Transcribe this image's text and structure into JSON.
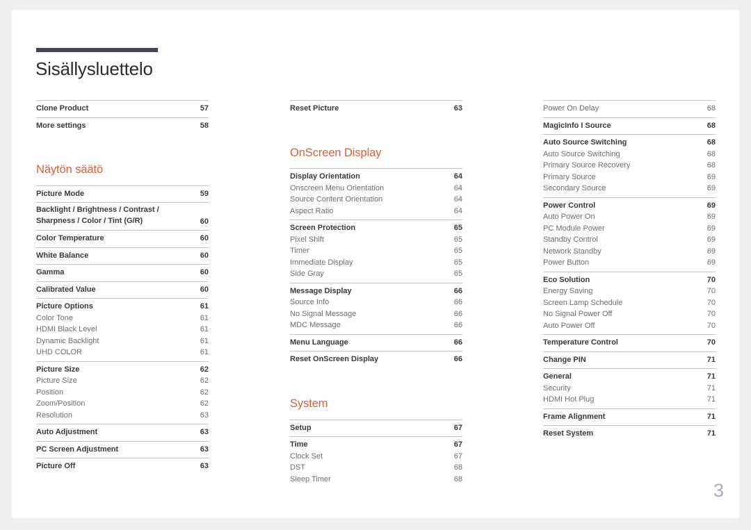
{
  "document": {
    "title": "Sisällysluettelo",
    "folio": "3",
    "accent_color": "#d4603c",
    "rule_color": "#464156"
  },
  "columns": [
    {
      "name": "column-1",
      "blocks": [
        {
          "type": "group",
          "rows": [
            {
              "label": "Clone Product",
              "page": "57",
              "level": "main"
            }
          ]
        },
        {
          "type": "group",
          "rows": [
            {
              "label": "More settings",
              "page": "58",
              "level": "main"
            }
          ]
        },
        {
          "type": "spacer",
          "size": "lg"
        },
        {
          "type": "heading",
          "label": "Näytön säätö"
        },
        {
          "type": "group",
          "rows": [
            {
              "label": "Picture Mode",
              "page": "59",
              "level": "main"
            }
          ]
        },
        {
          "type": "group",
          "rows": [
            {
              "label": "Backlight / Brightness / Contrast / Sharpness / Color / Tint (G/R)",
              "page": "60",
              "level": "main",
              "wrap": true
            }
          ]
        },
        {
          "type": "group",
          "rows": [
            {
              "label": "Color Temperature",
              "page": "60",
              "level": "main"
            }
          ]
        },
        {
          "type": "group",
          "rows": [
            {
              "label": "White Balance",
              "page": "60",
              "level": "main"
            }
          ]
        },
        {
          "type": "group",
          "rows": [
            {
              "label": "Gamma",
              "page": "60",
              "level": "main"
            }
          ]
        },
        {
          "type": "group",
          "rows": [
            {
              "label": "Calibrated Value",
              "page": "60",
              "level": "main"
            }
          ]
        },
        {
          "type": "group",
          "rows": [
            {
              "label": "Picture Options",
              "page": "61",
              "level": "main"
            },
            {
              "label": "Color Tone",
              "page": "61",
              "level": "sub"
            },
            {
              "label": "HDMI Black Level",
              "page": "61",
              "level": "sub"
            },
            {
              "label": "Dynamic Backlight",
              "page": "61",
              "level": "sub"
            },
            {
              "label": "UHD COLOR",
              "page": "61",
              "level": "sub"
            }
          ]
        },
        {
          "type": "group",
          "rows": [
            {
              "label": "Picture Size",
              "page": "62",
              "level": "main"
            },
            {
              "label": "Picture Size",
              "page": "62",
              "level": "sub"
            },
            {
              "label": "Position",
              "page": "62",
              "level": "sub"
            },
            {
              "label": "Zoom/Position",
              "page": "62",
              "level": "sub"
            },
            {
              "label": "Resolution",
              "page": "63",
              "level": "sub"
            }
          ]
        },
        {
          "type": "group",
          "rows": [
            {
              "label": "Auto Adjustment",
              "page": "63",
              "level": "main"
            }
          ]
        },
        {
          "type": "group",
          "rows": [
            {
              "label": "PC Screen Adjustment",
              "page": "63",
              "level": "main"
            }
          ]
        },
        {
          "type": "group",
          "rows": [
            {
              "label": "Picture Off",
              "page": "63",
              "level": "main"
            }
          ]
        }
      ]
    },
    {
      "name": "column-2",
      "blocks": [
        {
          "type": "group",
          "rows": [
            {
              "label": "Reset Picture",
              "page": "63",
              "level": "main"
            }
          ]
        },
        {
          "type": "spacer",
          "size": "lg"
        },
        {
          "type": "heading",
          "label": "OnScreen Display"
        },
        {
          "type": "group",
          "rows": [
            {
              "label": "Display Orientation",
              "page": "64",
              "level": "main"
            },
            {
              "label": "Onscreen Menu Orientation",
              "page": "64",
              "level": "sub"
            },
            {
              "label": "Source Content Orientation",
              "page": "64",
              "level": "sub"
            },
            {
              "label": "Aspect Ratio",
              "page": "64",
              "level": "sub"
            }
          ]
        },
        {
          "type": "group",
          "rows": [
            {
              "label": "Screen Protection",
              "page": "65",
              "level": "main"
            },
            {
              "label": "Pixel Shift",
              "page": "65",
              "level": "sub"
            },
            {
              "label": "Timer",
              "page": "65",
              "level": "sub"
            },
            {
              "label": "Immediate Display",
              "page": "65",
              "level": "sub"
            },
            {
              "label": "Side Gray",
              "page": "65",
              "level": "sub"
            }
          ]
        },
        {
          "type": "group",
          "rows": [
            {
              "label": "Message Display",
              "page": "66",
              "level": "main"
            },
            {
              "label": "Source Info",
              "page": "66",
              "level": "sub"
            },
            {
              "label": "No Signal Message",
              "page": "66",
              "level": "sub"
            },
            {
              "label": "MDC Message",
              "page": "66",
              "level": "sub"
            }
          ]
        },
        {
          "type": "group",
          "rows": [
            {
              "label": "Menu Language",
              "page": "66",
              "level": "main"
            }
          ]
        },
        {
          "type": "group",
          "rows": [
            {
              "label": "Reset OnScreen Display",
              "page": "66",
              "level": "main"
            }
          ]
        },
        {
          "type": "spacer",
          "size": "lg"
        },
        {
          "type": "heading",
          "label": "System"
        },
        {
          "type": "group",
          "rows": [
            {
              "label": "Setup",
              "page": "67",
              "level": "main"
            }
          ]
        },
        {
          "type": "group",
          "rows": [
            {
              "label": "Time",
              "page": "67",
              "level": "main"
            },
            {
              "label": "Clock Set",
              "page": "67",
              "level": "sub"
            },
            {
              "label": "DST",
              "page": "68",
              "level": "sub"
            },
            {
              "label": "Sleep Timer",
              "page": "68",
              "level": "sub"
            }
          ]
        }
      ]
    },
    {
      "name": "column-3",
      "blocks": [
        {
          "type": "group",
          "rows": [
            {
              "label": "Power On Delay",
              "page": "68",
              "level": "sub"
            }
          ]
        },
        {
          "type": "group",
          "rows": [
            {
              "label": "MagicInfo I Source",
              "page": "68",
              "level": "main"
            }
          ]
        },
        {
          "type": "group",
          "rows": [
            {
              "label": "Auto Source Switching",
              "page": "68",
              "level": "main"
            },
            {
              "label": "Auto Source Switching",
              "page": "68",
              "level": "sub"
            },
            {
              "label": "Primary Source Recovery",
              "page": "68",
              "level": "sub"
            },
            {
              "label": "Primary Source",
              "page": "69",
              "level": "sub"
            },
            {
              "label": "Secondary Source",
              "page": "69",
              "level": "sub"
            }
          ]
        },
        {
          "type": "group",
          "rows": [
            {
              "label": "Power Control",
              "page": "69",
              "level": "main"
            },
            {
              "label": "Auto Power On",
              "page": "69",
              "level": "sub"
            },
            {
              "label": "PC Module Power",
              "page": "69",
              "level": "sub"
            },
            {
              "label": "Standby Control",
              "page": "69",
              "level": "sub"
            },
            {
              "label": "Network Standby",
              "page": "69",
              "level": "sub"
            },
            {
              "label": "Power Button",
              "page": "69",
              "level": "sub"
            }
          ]
        },
        {
          "type": "group",
          "rows": [
            {
              "label": "Eco Solution",
              "page": "70",
              "level": "main"
            },
            {
              "label": "Energy Saving",
              "page": "70",
              "level": "sub"
            },
            {
              "label": "Screen Lamp Schedule",
              "page": "70",
              "level": "sub"
            },
            {
              "label": "No Signal Power Off",
              "page": "70",
              "level": "sub"
            },
            {
              "label": "Auto Power Off",
              "page": "70",
              "level": "sub"
            }
          ]
        },
        {
          "type": "group",
          "rows": [
            {
              "label": "Temperature Control",
              "page": "70",
              "level": "main"
            }
          ]
        },
        {
          "type": "group",
          "rows": [
            {
              "label": "Change PIN",
              "page": "71",
              "level": "main"
            }
          ]
        },
        {
          "type": "group",
          "rows": [
            {
              "label": "General",
              "page": "71",
              "level": "main"
            },
            {
              "label": "Security",
              "page": "71",
              "level": "sub"
            },
            {
              "label": "HDMI Hot Plug",
              "page": "71",
              "level": "sub"
            }
          ]
        },
        {
          "type": "group",
          "rows": [
            {
              "label": "Frame Alignment",
              "page": "71",
              "level": "main"
            }
          ]
        },
        {
          "type": "group",
          "rows": [
            {
              "label": "Reset System",
              "page": "71",
              "level": "main"
            }
          ]
        }
      ]
    }
  ]
}
